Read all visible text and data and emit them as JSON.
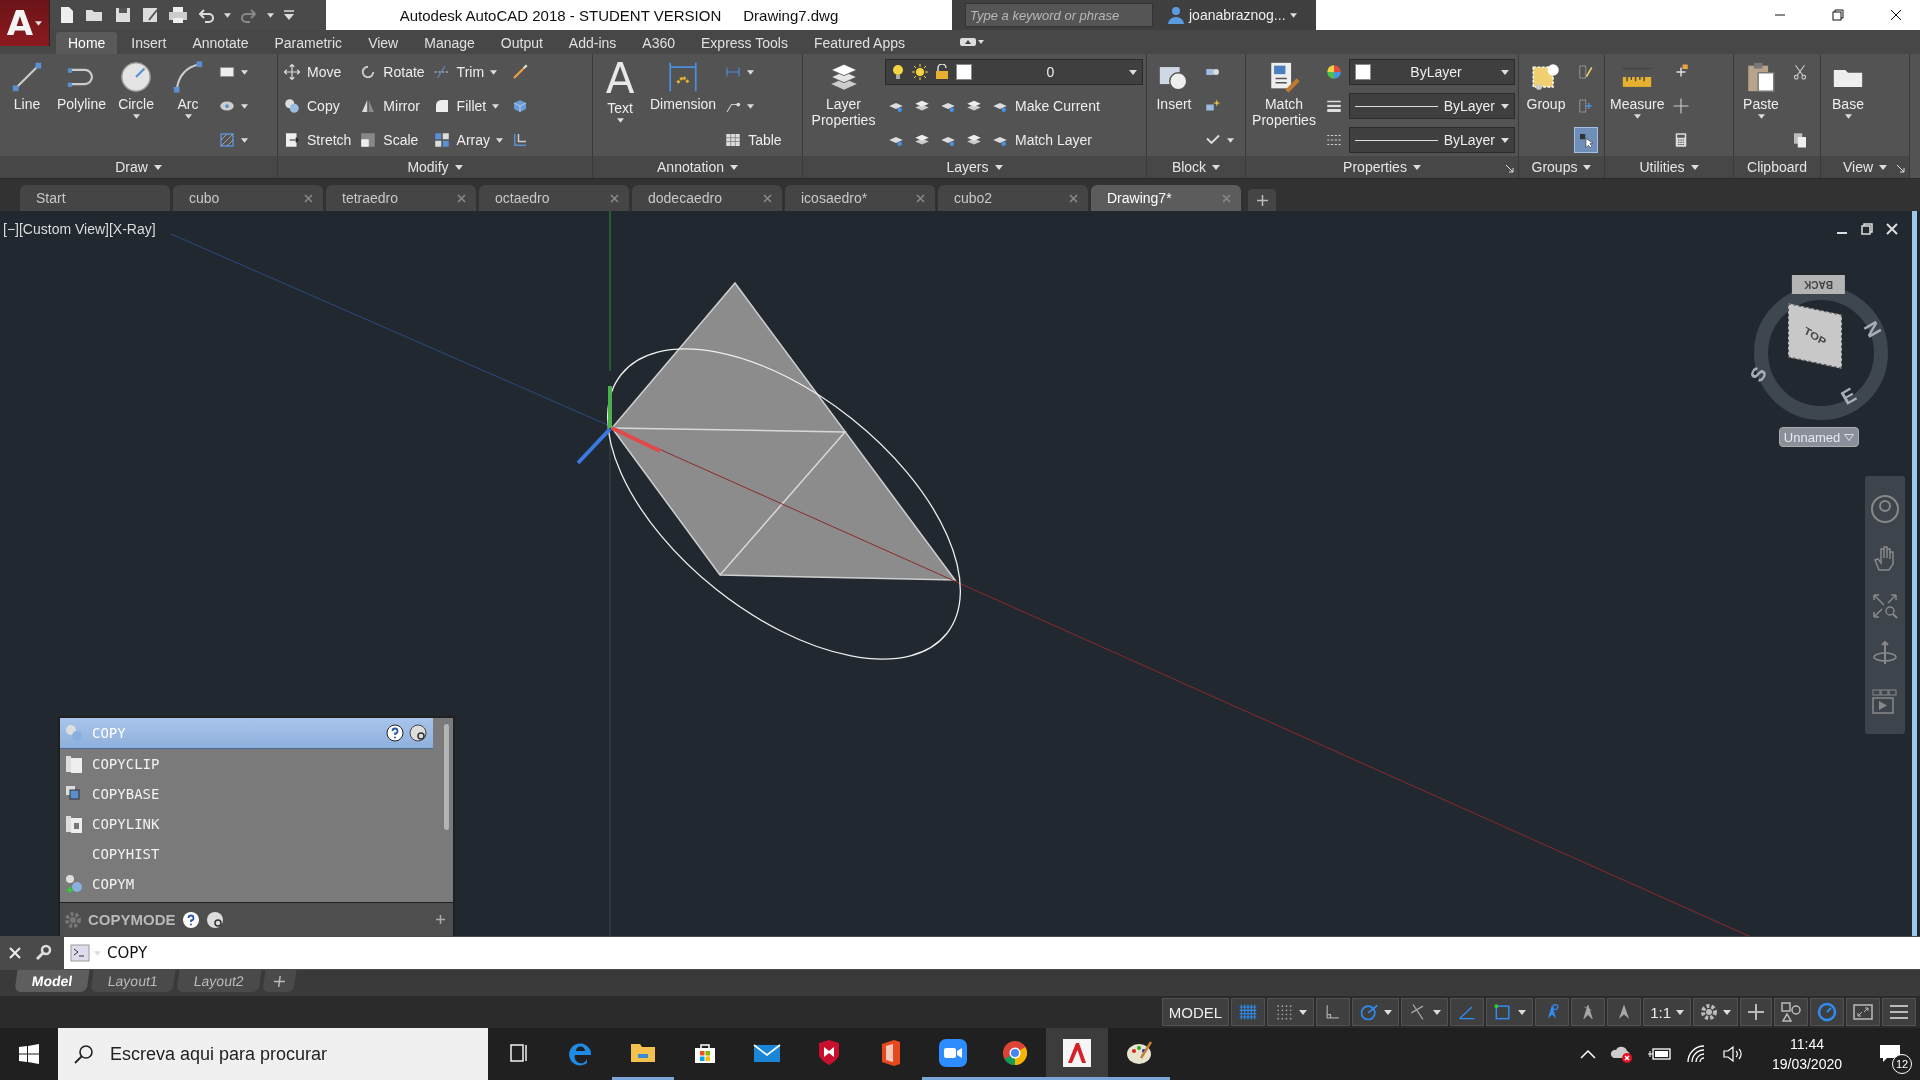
{
  "title_bar": {
    "app_logo": "A",
    "title": "Autodesk AutoCAD 2018 - STUDENT VERSION",
    "document": "Drawing7.dwg",
    "search": {
      "placeholder": "Type a keyword or phrase"
    },
    "user": "joanabraznog..."
  },
  "ribbon_tabs": [
    {
      "label": "Home",
      "selected": true
    },
    {
      "label": "Insert",
      "selected": false
    },
    {
      "label": "Annotate",
      "selected": false
    },
    {
      "label": "Parametric",
      "selected": false
    },
    {
      "label": "View",
      "selected": false
    },
    {
      "label": "Manage",
      "selected": false
    },
    {
      "label": "Output",
      "selected": false
    },
    {
      "label": "Add-ins",
      "selected": false
    },
    {
      "label": "A360",
      "selected": false
    },
    {
      "label": "Express Tools",
      "selected": false
    },
    {
      "label": "Featured Apps",
      "selected": false
    }
  ],
  "ribbon_panels": [
    {
      "title": "Draw",
      "menu": true,
      "launcher": false,
      "tools": [
        {
          "kind": "large",
          "label": "Line",
          "dropdown": false
        },
        {
          "kind": "large",
          "label": "Polyline",
          "dropdown": false
        },
        {
          "kind": "large",
          "label": "Circle",
          "dropdown": true
        },
        {
          "kind": "large",
          "label": "Arc",
          "dropdown": true
        },
        {
          "kind": "column",
          "items": [
            {
              "kind": "icon",
              "dropdown": true
            },
            {
              "kind": "icon",
              "dropdown": true
            },
            {
              "kind": "icon",
              "dropdown": true
            }
          ]
        }
      ]
    },
    {
      "title": "Modify",
      "menu": true,
      "launcher": false,
      "tools": [
        {
          "kind": "column",
          "items": [
            {
              "kind": "small",
              "label": "Move",
              "dropdown": false
            },
            {
              "kind": "small",
              "label": "Copy",
              "dropdown": false
            },
            {
              "kind": "small",
              "label": "Stretch",
              "dropdown": false
            }
          ]
        },
        {
          "kind": "column",
          "items": [
            {
              "kind": "small",
              "label": "Rotate",
              "dropdown": false
            },
            {
              "kind": "small",
              "label": "Mirror",
              "dropdown": false
            },
            {
              "kind": "small",
              "label": "Scale",
              "dropdown": false
            }
          ]
        },
        {
          "kind": "column",
          "items": [
            {
              "kind": "small",
              "label": "Trim",
              "dropdown": true
            },
            {
              "kind": "small",
              "label": "Fillet",
              "dropdown": true
            },
            {
              "kind": "small",
              "label": "Array",
              "dropdown": true
            }
          ]
        },
        {
          "kind": "column",
          "items": [
            {
              "kind": "icon",
              "dropdown": false
            },
            {
              "kind": "icon",
              "dropdown": false
            },
            {
              "kind": "icon",
              "dropdown": false
            }
          ]
        }
      ]
    },
    {
      "title": "Annotation",
      "menu": true,
      "launcher": false,
      "tools": [
        {
          "kind": "large",
          "label": "Text",
          "glyph": "A",
          "dropdown": true
        },
        {
          "kind": "large",
          "label": "Dimension",
          "dropdown": false
        },
        {
          "kind": "column",
          "items": [
            {
              "kind": "icon",
              "dropdown": true
            },
            {
              "kind": "icon",
              "dropdown": true
            },
            {
              "kind": "small",
              "label": "Table",
              "dropdown": false
            }
          ]
        }
      ]
    },
    {
      "title": "Layers",
      "menu": true,
      "launcher": false,
      "tools": [
        {
          "kind": "large",
          "label": "Layer Properties",
          "dropdown": false
        },
        {
          "kind": "column",
          "items": [
            {
              "kind": "layer-select",
              "value": "0"
            },
            {
              "kind": "row",
              "items": [
                {
                  "kind": "icon",
                  "dropdown": false
                },
                {
                  "kind": "icon",
                  "dropdown": false
                },
                {
                  "kind": "icon",
                  "dropdown": false
                },
                {
                  "kind": "icon",
                  "dropdown": false
                },
                {
                  "kind": "small",
                  "label": "Make Current",
                  "dropdown": false
                }
              ]
            },
            {
              "kind": "row",
              "items": [
                {
                  "kind": "icon",
                  "dropdown": false
                },
                {
                  "kind": "icon",
                  "dropdown": false
                },
                {
                  "kind": "icon",
                  "dropdown": false
                },
                {
                  "kind": "icon",
                  "dropdown": false
                },
                {
                  "kind": "small",
                  "label": "Match Layer",
                  "dropdown": false
                }
              ]
            }
          ]
        }
      ]
    },
    {
      "title": "Block",
      "menu": true,
      "launcher": false,
      "tools": [
        {
          "kind": "large",
          "label": "Insert",
          "dropdown": false
        },
        {
          "kind": "column",
          "items": [
            {
              "kind": "icon",
              "dropdown": false
            },
            {
              "kind": "icon",
              "dropdown": false
            },
            {
              "kind": "icon",
              "dropdown": true
            }
          ]
        }
      ]
    },
    {
      "title": "Properties",
      "menu": true,
      "launcher": true,
      "tools": [
        {
          "kind": "large",
          "label": "Match Properties",
          "dropdown": false
        },
        {
          "kind": "column",
          "items": [
            {
              "kind": "row",
              "items": [
                {
                  "kind": "icon",
                  "dropdown": false
                },
                {
                  "kind": "color-select",
                  "value": "ByLayer"
                }
              ]
            },
            {
              "kind": "row",
              "items": [
                {
                  "kind": "icon",
                  "dropdown": false
                },
                {
                  "kind": "line-select",
                  "value": "ByLayer"
                }
              ]
            },
            {
              "kind": "row",
              "items": [
                {
                  "kind": "icon",
                  "dropdown": false
                },
                {
                  "kind": "line-select",
                  "value": "ByLayer"
                }
              ]
            }
          ]
        }
      ]
    },
    {
      "title": "Groups",
      "menu": true,
      "launcher": false,
      "tools": [
        {
          "kind": "large",
          "label": "Group",
          "dropdown": false
        },
        {
          "kind": "column",
          "items": [
            {
              "kind": "icon",
              "dropdown": false,
              "on": false
            },
            {
              "kind": "icon",
              "dropdown": false,
              "on": false
            },
            {
              "kind": "icon",
              "dropdown": false,
              "on": true
            }
          ]
        }
      ]
    },
    {
      "title": "Utilities",
      "menu": true,
      "launcher": false,
      "tools": [
        {
          "kind": "large",
          "label": "Measure",
          "dropdown": true
        },
        {
          "kind": "column",
          "items": [
            {
              "kind": "icon",
              "dropdown": false
            },
            {
              "kind": "icon",
              "dropdown": false
            },
            {
              "kind": "icon",
              "dropdown": false
            }
          ]
        }
      ]
    },
    {
      "title": "Clipboard",
      "menu": false,
      "launcher": false,
      "tools": [
        {
          "kind": "large",
          "label": "Paste",
          "dropdown": true
        },
        {
          "kind": "column",
          "items": [
            {
              "kind": "icon",
              "dropdown": false
            },
            {
              "kind": "icon",
              "dropdown": false
            }
          ]
        }
      ]
    },
    {
      "title": "View",
      "menu": true,
      "launcher": true,
      "tools": [
        {
          "kind": "large",
          "label": "Base",
          "dropdown": true
        }
      ]
    }
  ],
  "file_tabs": [
    {
      "label": "Start",
      "selected": false
    },
    {
      "label": "cubo",
      "selected": false
    },
    {
      "label": "tetraedro",
      "selected": false
    },
    {
      "label": "octaedro",
      "selected": false
    },
    {
      "label": "dodecaedro",
      "selected": false
    },
    {
      "label": "icosaedro*",
      "selected": false
    },
    {
      "label": "cubo2",
      "selected": false
    },
    {
      "label": "Drawing7*",
      "selected": true
    }
  ],
  "viewport": {
    "view_label": "[−][Custom View][X-Ray]",
    "viewcube": {
      "top_face": "TOP",
      "back_face": "BACK",
      "north": "N",
      "south": "S",
      "east": "E",
      "view_name": "Unnamed"
    }
  },
  "command_suggestions": {
    "items": [
      {
        "label": "COPY",
        "selected": true
      },
      {
        "label": "COPYCLIP",
        "selected": false
      },
      {
        "label": "COPYBASE",
        "selected": false
      },
      {
        "label": "COPYLINK",
        "selected": false
      },
      {
        "label": "COPYHIST",
        "selected": false
      },
      {
        "label": "COPYM",
        "selected": false
      }
    ],
    "footer": "COPYMODE"
  },
  "command_line": {
    "value": "COPY"
  },
  "layout_tabs": [
    {
      "label": "Model",
      "selected": true
    },
    {
      "label": "Layout1",
      "selected": false
    },
    {
      "label": "Layout2",
      "selected": false
    }
  ],
  "status_bar": {
    "space": "MODEL",
    "toggles": [
      {
        "on": true,
        "dropdown": false
      },
      {
        "on": false,
        "dropdown": true
      },
      {
        "on": false,
        "dropdown": false
      },
      {
        "on": true,
        "dropdown": true
      },
      {
        "on": false,
        "dropdown": true
      },
      {
        "on": true,
        "dropdown": false
      },
      {
        "on": true,
        "dropdown": true
      },
      {
        "on": true,
        "dropdown": false
      },
      {
        "on": false,
        "dropdown": false
      },
      {
        "on": false,
        "dropdown": false
      }
    ],
    "scale": "1:1",
    "acceleration_on": true
  },
  "taskbar": {
    "search": {
      "placeholder": "Escreva aqui para procurar"
    },
    "apps": [
      {
        "running": false,
        "active": false
      },
      {
        "running": false,
        "active": false
      },
      {
        "running": true,
        "active": false
      },
      {
        "running": false,
        "active": false
      },
      {
        "running": false,
        "active": false
      },
      {
        "running": false,
        "active": false
      },
      {
        "running": false,
        "active": false
      },
      {
        "running": true,
        "active": false
      },
      {
        "running": true,
        "active": false
      },
      {
        "running": true,
        "active": true
      },
      {
        "running": true,
        "active": false
      }
    ],
    "time": "11:44",
    "date": "19/03/2020",
    "notifications": "12"
  }
}
